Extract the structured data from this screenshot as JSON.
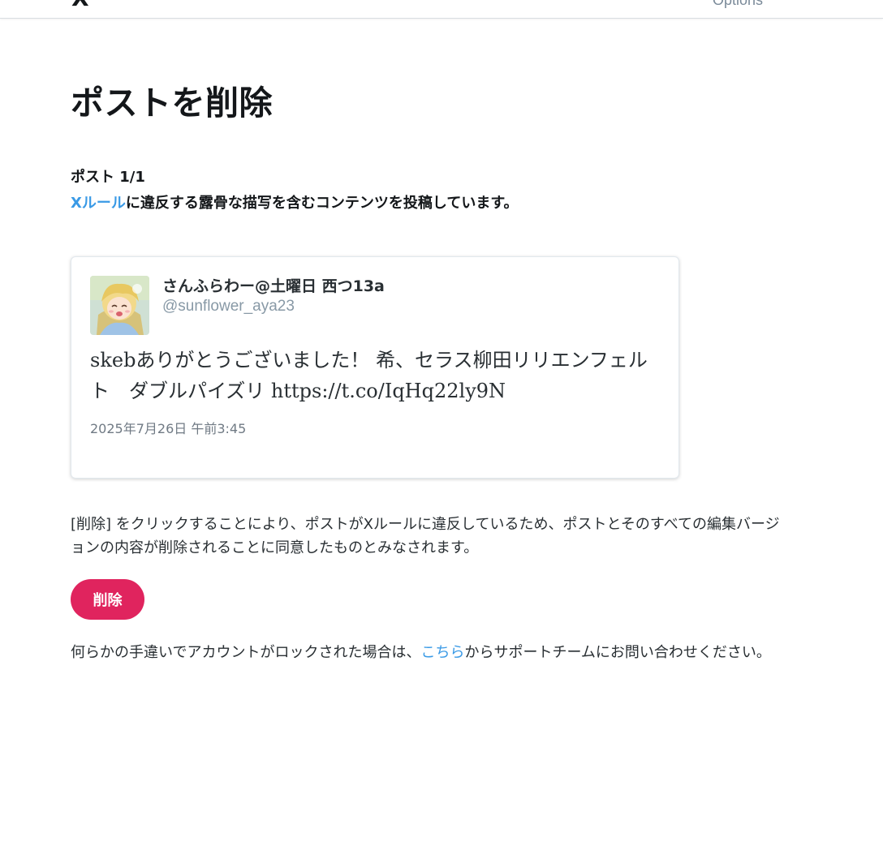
{
  "header": {
    "logo_text": "X",
    "options_label": "Options"
  },
  "page": {
    "title": "ポストを削除",
    "post_count": "ポスト 1/1",
    "violation": {
      "rule_link": "Xルール",
      "text": "に違反する露骨な描写を含むコンテンツを投稿しています。"
    }
  },
  "tweet": {
    "author_name": "さんふらわー@土曜日 西つ13a",
    "author_handle": "@sunflower_aya23",
    "text": "skebありがとうございました！ 希、セラス柳田リリエンフェルト　ダブルパイズリ https://t.co/IqHq22ly9N",
    "timestamp": "2025年7月26日 午前3:45"
  },
  "agreement_text": "[削除] をクリックすることにより、ポストがXルールに違反しているため、ポストとそのすべての編集バージョンの内容が削除されることに同意したものとみなされます。",
  "delete_button_label": "削除",
  "help": {
    "before": "何らかの手違いでアカウントがロックされた場合は、",
    "link": "こちら",
    "after": "からサポートチームにお問い合わせください。"
  },
  "colors": {
    "link": "#3a9ae6",
    "delete_button": "#e0245e",
    "text": "#14171a"
  }
}
